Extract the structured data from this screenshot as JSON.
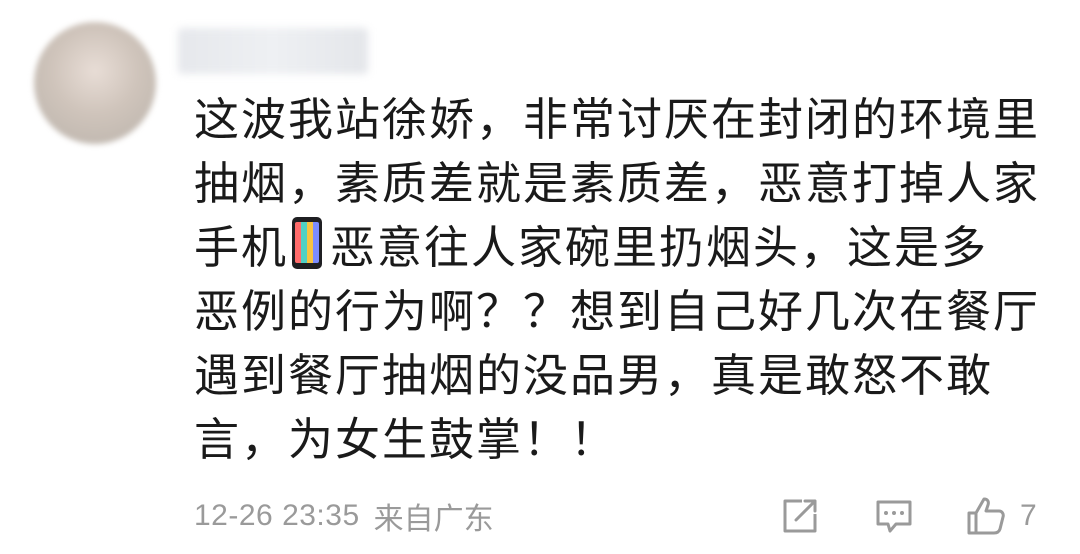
{
  "comment": {
    "text_lines": [
      "这波我站徐娇，非常讨厌在封闭的环境里",
      "抽烟，素质差就是素质差，恶意打掉人家",
      "手机",
      "恶意往人家碗里扔烟头，这是多",
      "恶例的行为啊？？想到自己好几次在餐厅",
      "遇到餐厅抽烟的没品男，真是敢怒不敢",
      "言，为女生鼓掌！！"
    ],
    "emoji": "mobile-phone-emoji",
    "timestamp": "12-26 23:35",
    "location": "来自广东",
    "like_count": "7"
  },
  "icons": {
    "share": "share-icon",
    "reply": "reply-icon",
    "like": "thumbs-up-icon"
  },
  "colors": {
    "text": "#1a1a1a",
    "meta": "#9a9a9a",
    "background": "#ffffff"
  }
}
